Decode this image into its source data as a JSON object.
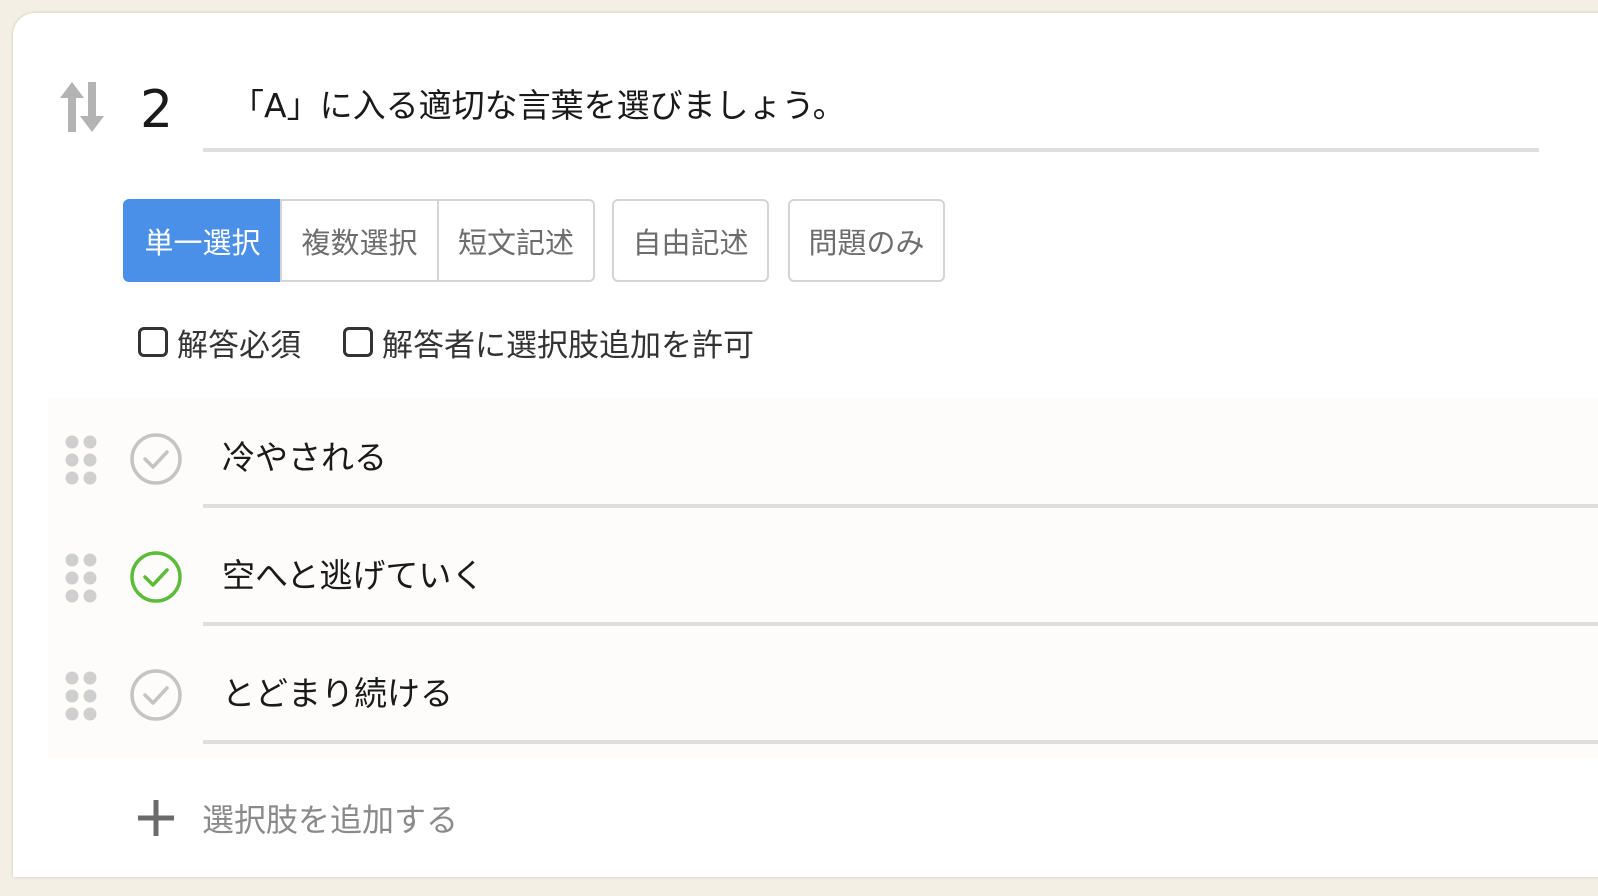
{
  "question": {
    "number": "2",
    "title": "「A」に入る適切な言葉を選びましょう。"
  },
  "answer_types": {
    "single": "単一選択",
    "multiple": "複数選択",
    "short_text": "短文記述",
    "free_text": "自由記述",
    "question_only": "問題のみ",
    "active": "single"
  },
  "settings": {
    "required_label": "解答必須",
    "required_checked": false,
    "allow_add_label": "解答者に選択肢追加を許可",
    "allow_add_checked": false
  },
  "choices": [
    {
      "text": "冷やされる",
      "correct": false
    },
    {
      "text": "空へと逃げていく",
      "correct": true
    },
    {
      "text": "とどまり続ける",
      "correct": false
    }
  ],
  "add_choice_label": "選択肢を追加する",
  "colors": {
    "accent": "#4a90e8",
    "correct": "#5dbb3a",
    "inactive_check": "#c4c4c4"
  }
}
